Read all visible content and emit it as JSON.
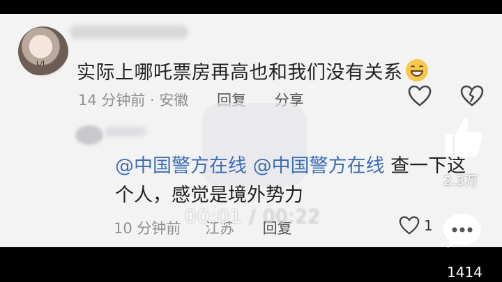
{
  "comment1": {
    "text": "实际上哪吒票房再高也和我们没有关系",
    "emoji": "grinning-sweat-emoji",
    "time_location": "14 分钟前 · 安徽",
    "reply": "回复",
    "share": "分享"
  },
  "comment2": {
    "mention1": "@中国警方在线",
    "mention2": "@中国警方在线",
    "text": " 查一下这个人，感觉是境外势力",
    "time": "10 分钟前",
    "location": "江苏",
    "reply": "回复",
    "like_count": "1"
  },
  "player": {
    "current_time": "00:01",
    "separator": " / ",
    "total_time": "00:22"
  },
  "side": {
    "like_count": "2.3万",
    "comment_count": "1414"
  },
  "avatar_tag": "L/L",
  "colors": {
    "background": "#f3f3f4",
    "mention": "#3d6fb8",
    "meta": "#8f8f93"
  }
}
